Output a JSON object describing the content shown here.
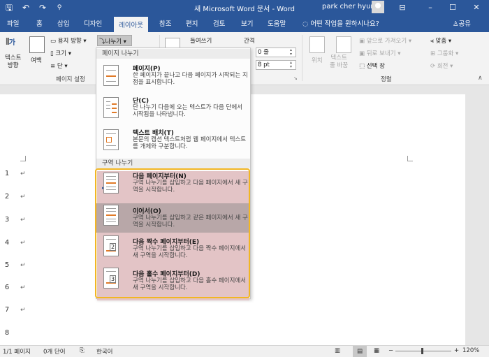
{
  "window": {
    "title": "새 Microsoft Word 문서 - Word",
    "user": "park cher hyun"
  },
  "tabs": [
    "파일",
    "홈",
    "삽입",
    "디자인",
    "레이아웃",
    "참조",
    "편지",
    "검토",
    "보기",
    "도움말"
  ],
  "active_tab": "레이아웃",
  "tell_me": "어떤 작업을 원하시나요?",
  "share": "공유",
  "ribbon": {
    "text_direction": "텍스트\n방향",
    "margins": "여백",
    "orientation": "용지 방향",
    "size": "크기",
    "columns": "단",
    "breaks": "나누기",
    "page_setup_label": "페이지 설정",
    "indent_label": "들여쓰기",
    "spacing_label": "간격",
    "spacing_before": "0 줄",
    "spacing_after": "8 pt",
    "position": "위치",
    "wrap_text": "텍스트\n줄 바꿈",
    "bring_forward": "앞으로 가져오기",
    "send_backward": "뒤로 보내기",
    "selection_pane": "선택 창",
    "align": "맞춤",
    "group": "그룹화",
    "rotate": "회전",
    "arrange_label": "정렬"
  },
  "menu": {
    "page_breaks_header": "페이지 나누기",
    "section_breaks_header": "구역 나누기",
    "items": [
      {
        "title": "페이지(P)",
        "desc": "한 페이지가 끝나고 다음 페이지가 시작되는 지점을 표시합니다."
      },
      {
        "title": "단(C)",
        "desc": "단 나누기 다음에 오는 텍스트가 다음 단에서 시작됨을 나타냅니다."
      },
      {
        "title": "텍스트 배치(T)",
        "desc": "본문의 캡션 텍스트처럼 웹 페이지에서 텍스트를 개체와 구분합니다."
      },
      {
        "title": "다음 페이지부터(N)",
        "desc": "구역 나누기를 삽입하고 다음 페이지에서 새 구역을 시작합니다."
      },
      {
        "title": "이어서(O)",
        "desc": "구역 나누기를 삽입하고 같은 페이지에서 새 구역을 시작합니다."
      },
      {
        "title": "다음 짝수 페이지부터(E)",
        "desc": "구역 나누기를 삽입하고 다음 짝수 페이지에서 새 구역을 시작합니다."
      },
      {
        "title": "다음 홀수 페이지부터(D)",
        "desc": "구역 나누기를 삽입하고 다음 홀수 페이지에서 새 구역을 시작합니다."
      }
    ],
    "even_icon_label": "2",
    "odd_icon_label": "3"
  },
  "doc": {
    "line_numbers": [
      "1",
      "2",
      "3",
      "4",
      "5",
      "6",
      "7",
      "8"
    ],
    "para_mark": "↵"
  },
  "status": {
    "page": "1/1 페이지",
    "words": "0개 단어",
    "language": "한국어",
    "zoom": "120%"
  }
}
